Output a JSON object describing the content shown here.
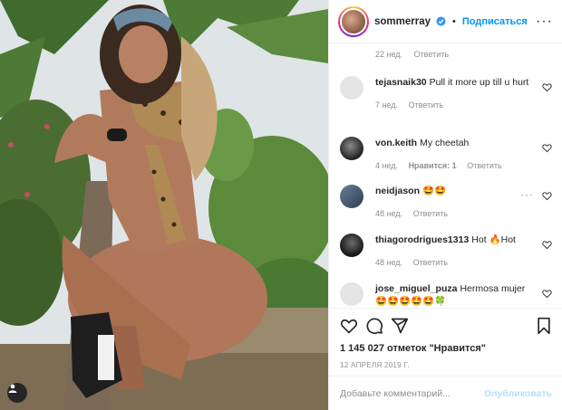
{
  "header": {
    "username": "sommerray",
    "separator": "•",
    "follow_label": "Подписаться",
    "more_label": "···"
  },
  "comments": {
    "previous_meta": {
      "time": "22 нед.",
      "reply": "Ответить"
    },
    "items": [
      {
        "user": "tejasnaik30",
        "text": "Pull it more up till u hurt",
        "time": "7 нед.",
        "likes": "",
        "reply": "Ответить",
        "avatar_color": "#dbdbdb"
      },
      {
        "user": "von.keith",
        "text": "My cheetah",
        "time": "4 нед.",
        "likes": "Нравится: 1",
        "reply": "Ответить",
        "avatar_color": "#3a3a3a"
      },
      {
        "user": "neidjason",
        "text": "🤩🤩",
        "time": "48 нед.",
        "likes": "",
        "reply": "Ответить",
        "avatar_color": "#4a5a6a"
      },
      {
        "user": "thiagorodrigues1313",
        "text": "Hot 🔥Hot",
        "time": "48 нед.",
        "likes": "",
        "reply": "Ответить",
        "avatar_color": "#2b2b2b"
      },
      {
        "user": "jose_miguel_puza",
        "text": "Hermosa mujer 🤩🤩🤩🤩🤩🍀",
        "time": "",
        "likes": "",
        "reply": "",
        "avatar_color": "#dbdbdb"
      }
    ]
  },
  "post": {
    "likes_text": "1 145 027 отметок \"Нравится\"",
    "date_text": "12 АПРЕЛЯ 2019 Г."
  },
  "composer": {
    "placeholder": "Добавьте комментарий...",
    "publish_label": "Опубликовать"
  },
  "icons": {
    "like": "heart-icon",
    "comment": "comment-icon",
    "share": "share-icon",
    "save": "bookmark-icon",
    "tag": "user-tag-icon",
    "verified": "verified-badge-icon"
  },
  "colors": {
    "accent": "#0095f6",
    "publish_disabled": "#b2dffc",
    "muted": "#8e8e8e",
    "text": "#262626"
  }
}
